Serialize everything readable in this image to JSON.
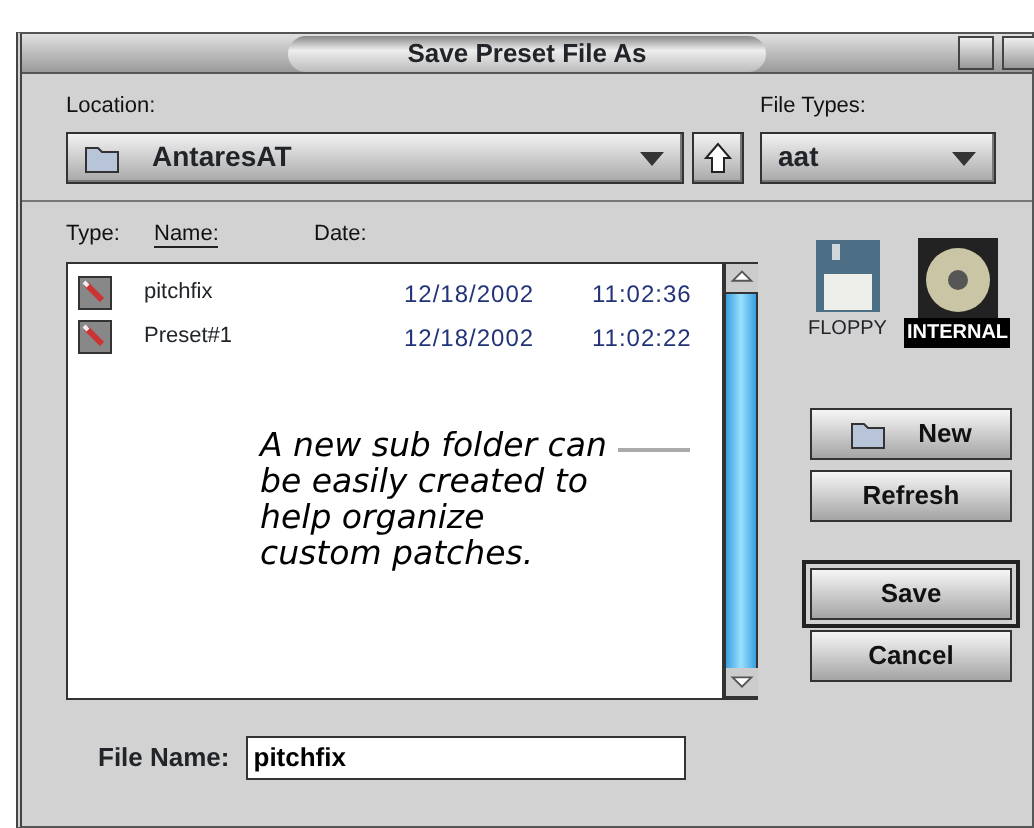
{
  "window": {
    "title": "Save Preset File As"
  },
  "location": {
    "label": "Location:",
    "value": "AntaresAT"
  },
  "file_types": {
    "label": "File Types:",
    "value": "aat"
  },
  "columns": [
    {
      "label": "Type:",
      "selected": false
    },
    {
      "label": "Name:",
      "selected": true
    },
    {
      "label": "Date:",
      "selected": false
    }
  ],
  "files": [
    {
      "name": "pitchfix",
      "date": "12/18/2002",
      "time": "11:02:36"
    },
    {
      "name": "Preset#1",
      "date": "12/18/2002",
      "time": "11:02:22"
    }
  ],
  "volumes": [
    {
      "label": "FLOPPY",
      "kind": "floppy",
      "selected": false
    },
    {
      "label": "INTERNAL",
      "kind": "disk",
      "selected": true
    }
  ],
  "buttons": [
    {
      "label": "New",
      "kind": "folder"
    },
    {
      "label": "Refresh",
      "kind": "plain"
    },
    {
      "label": "Save",
      "kind": "default"
    },
    {
      "label": "Cancel",
      "kind": "plain"
    }
  ],
  "file_name": {
    "label": "File Name:",
    "value": "pitchfix"
  },
  "annotation": "A new sub folder can be easily created to help organize custom patches."
}
